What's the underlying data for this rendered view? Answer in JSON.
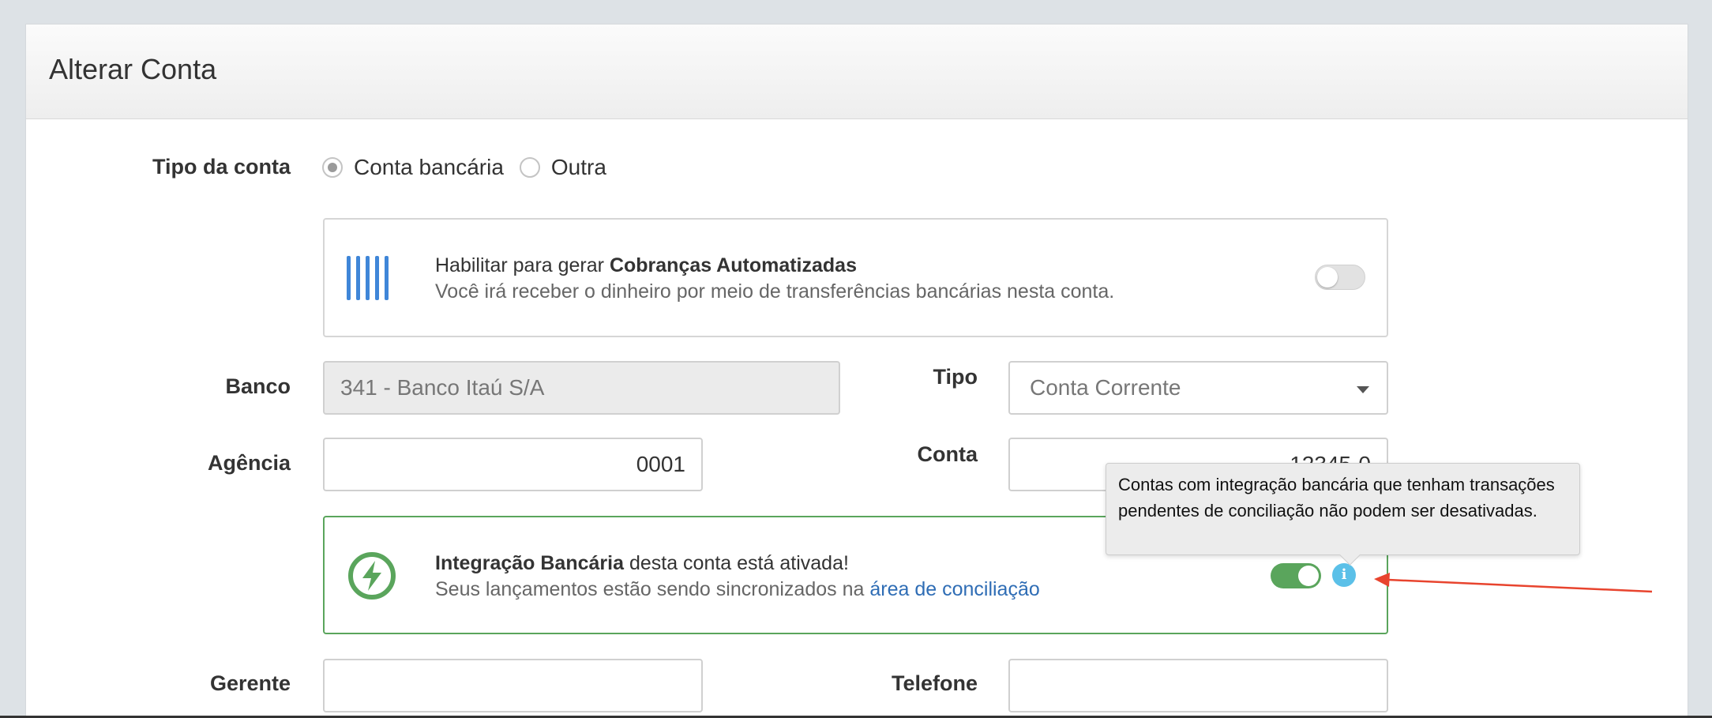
{
  "panel": {
    "title": "Alterar Conta"
  },
  "account_type": {
    "label": "Tipo da conta",
    "options": [
      {
        "label": "Conta bancária",
        "checked": true
      },
      {
        "label": "Outra",
        "checked": false
      }
    ]
  },
  "auto_billing": {
    "prefix": "Habilitar para gerar ",
    "title": "Cobranças Automatizadas",
    "description": "Você irá receber o dinheiro por meio de transferências bancárias nesta conta.",
    "enabled": false,
    "icon": "barcode-icon"
  },
  "fields": {
    "banco": {
      "label": "Banco",
      "value": "341 - Banco Itaú S/A"
    },
    "tipo": {
      "label": "Tipo",
      "value": "Conta Corrente"
    },
    "agencia": {
      "label": "Agência",
      "value": "0001"
    },
    "conta": {
      "label": "Conta",
      "value": "12345-0"
    },
    "gerente": {
      "label": "Gerente",
      "value": ""
    },
    "telefone": {
      "label": "Telefone",
      "value": ""
    }
  },
  "integration": {
    "title": "Integração Bancária",
    "title_suffix": " desta conta está ativada!",
    "line2_prefix": "Seus lançamentos estão sendo sincronizados na ",
    "link_text": "área de conciliação",
    "enabled": true,
    "icon": "lightning-icon"
  },
  "tooltip": {
    "text": "Contas com integração bancária que tenham transações pendentes de conciliação não podem ser desativadas."
  },
  "colors": {
    "accent_blue": "#3f86d8",
    "success_green": "#5aa55c",
    "info_blue": "#5bc0e8",
    "annotation_red": "#e8442e",
    "link_blue": "#2f6db5"
  }
}
